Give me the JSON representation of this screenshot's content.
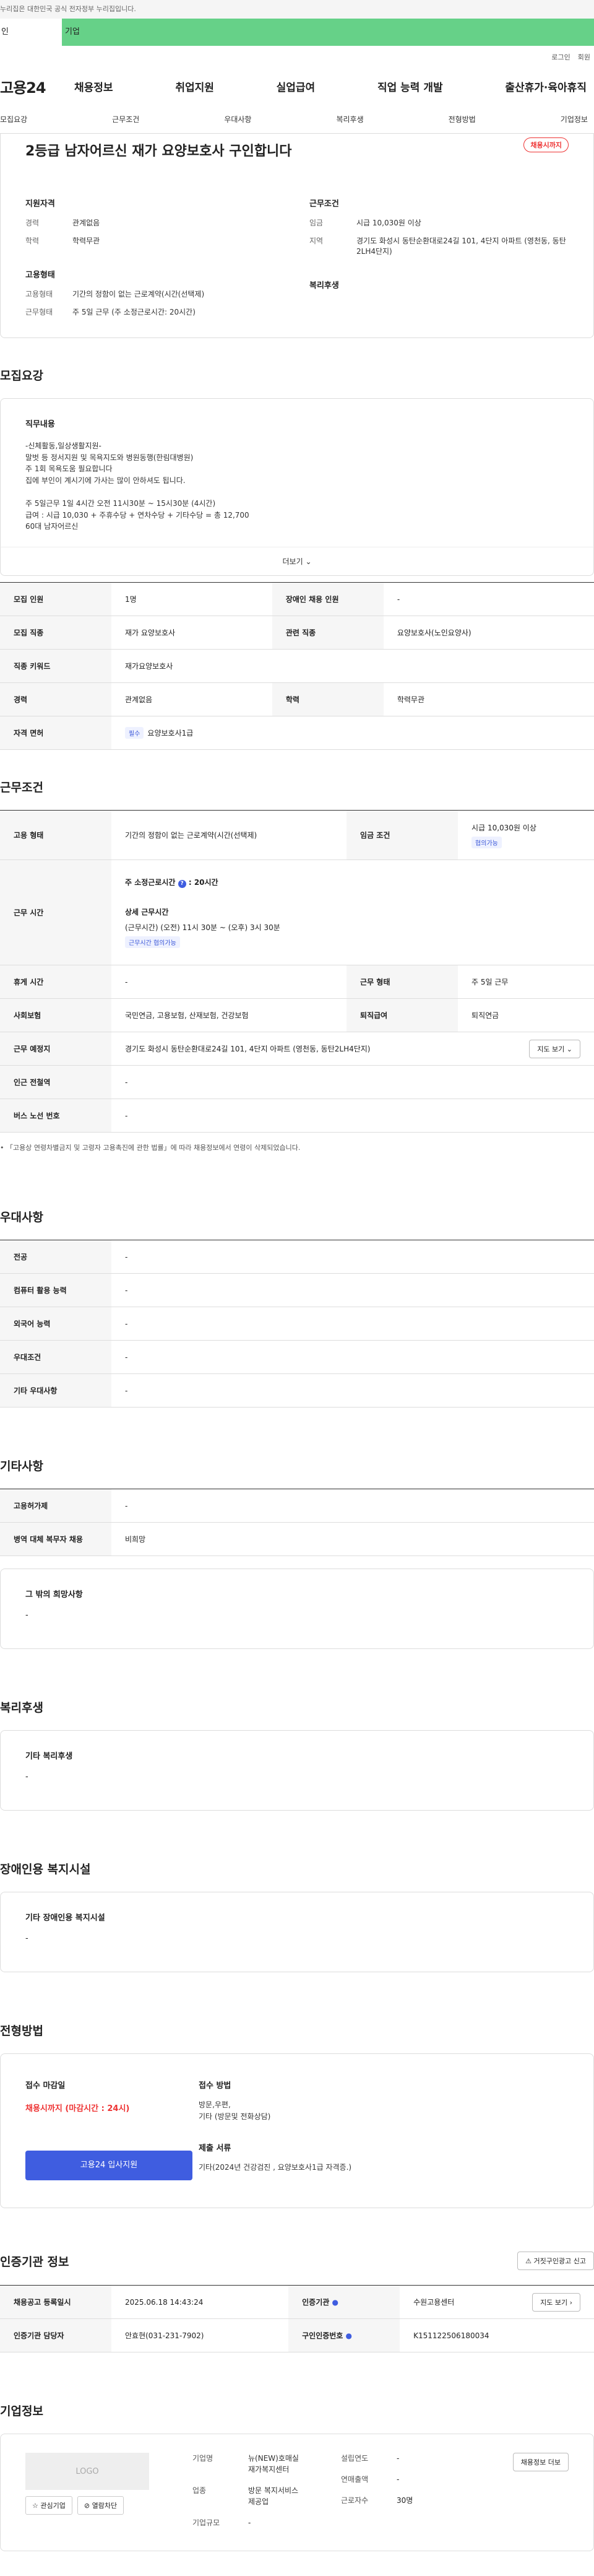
{
  "gov_notice": "누리집은 대한민국 공식 전자정부 누리집입니다.",
  "user_tabs": [
    "인",
    "기업"
  ],
  "top_links": [
    "로그인",
    "회원"
  ],
  "logo": "고용24",
  "gnb": [
    "채용정보",
    "취업지원",
    "실업급여",
    "직업 능력 개발",
    "출산휴가·육아휴직"
  ],
  "subnav": [
    "모집요강",
    "근무조건",
    "우대사항",
    "복리후생",
    "전형방법",
    "기업정보"
  ],
  "hero": {
    "title": "2등급 남자어르신 재가 요양보호사 구인합니다",
    "badge": "채용시까지",
    "qual_heading": "지원자격",
    "qual": [
      {
        "k": "경력",
        "v": "관계없음"
      },
      {
        "k": "학력",
        "v": "학력무관"
      }
    ],
    "cond_heading": "근무조건",
    "cond": [
      {
        "k": "임금",
        "v": "시급 10,030원 이상"
      },
      {
        "k": "지역",
        "v": "경기도 화성시 동탄순환대로24길 101, 4단지 아파트 (영천동, 동탄2LH4단지)"
      }
    ],
    "emp_heading": "고용형태",
    "emp": [
      {
        "k": "고용형태",
        "v": "기간의 정함이 없는 근로계약(시간(선택제)"
      },
      {
        "k": "근무형태",
        "v": "주 5일 근무 (주 소정근로시간: 20시간)"
      }
    ],
    "welfare_heading": "복리후생"
  },
  "recruit": {
    "title": "모집요강",
    "job_heading": "직무내용",
    "job_text": "-신체활동,일상생활지원-\n말벗 등 정서지원 및 목욕지도와 병원동행(한림대병원)\n주 1회 목욕도움 필요합니다\n집에 부인이 계시기에 가사는 많이 안하셔도 됩니다.\n\n주 5일근무 1일 4시간 오전 11시30분 ~ 15시30분 (4시간)\n급여 : 시급 10,030 + 주휴수당 + 연차수당 + 기타수당 = 총 12,700\n60대 남자어르신",
    "more": "더보기",
    "rows": [
      {
        "k1": "모집 인원",
        "v1": "1명",
        "k2": "장애인 채용 인원",
        "v2": "-"
      },
      {
        "k1": "모집 직종",
        "v1": "재가 요양보호사",
        "k2": "관련 직종",
        "v2": "요양보호사(노인요양사)"
      },
      {
        "k1": "직종 키워드",
        "v1": "재가요양보호사"
      },
      {
        "k1": "경력",
        "v1": "관계없음",
        "k2": "학력",
        "v2": "학력무관"
      },
      {
        "k1": "자격 면허",
        "v1": "요양보호사1급",
        "chip": "필수"
      }
    ]
  },
  "work": {
    "title": "근무조건",
    "type_k": "고용 형태",
    "type_v": "기간의 정함이 없는 근로계약(시간(선택제)",
    "wage_k": "임금 조건",
    "wage_v": "시급 10,030원 이상",
    "wage_chip": "협의가능",
    "hours_k": "근무 시간",
    "hours_weekly": "주 소정근로시간",
    "hours_weekly_v": "20시간",
    "hours_detail_h": "상세 근무시간",
    "hours_detail": "(근무시간) (오전) 11시 30분 ~ (오후) 3시 30분",
    "hours_chip": "근무시간 협의가능",
    "rest_k": "휴게 시간",
    "rest_v": "-",
    "form_k": "근무 형태",
    "form_v": "주 5일 근무",
    "ins_k": "사회보험",
    "ins_v": "국민연금, 고용보험, 산재보험, 건강보험",
    "ret_k": "퇴직급여",
    "ret_v": "퇴직연금",
    "place_k": "근무 예정지",
    "place_v": "경기도 화성시 동탄순환대로24길 101, 4단지 아파트 (영천동, 동탄2LH4단지)",
    "map_btn": "지도 보기",
    "subway_k": "인근 전철역",
    "subway_v": "-",
    "bus_k": "버스 노선 번호",
    "bus_v": "-",
    "note": "「고용상 연령차별금지 및 고령자 고용촉진에 관한 법률」에 따라 채용정보에서 연령이 삭제되었습니다."
  },
  "pref": {
    "title": "우대사항",
    "rows": [
      {
        "k": "전공",
        "v": "-"
      },
      {
        "k": "컴퓨터 활용 능력",
        "v": "-"
      },
      {
        "k": "외국어 능력",
        "v": "-"
      },
      {
        "k": "우대조건",
        "v": "-"
      },
      {
        "k": "기타 우대사항",
        "v": "-"
      }
    ]
  },
  "etc": {
    "title": "기타사항",
    "rows": [
      {
        "k": "고용허가제",
        "v": "-"
      },
      {
        "k": "병역 대체 복무자 채용",
        "v": "비희망"
      }
    ],
    "wish_h": "그 밖의 희망사항",
    "wish_v": "-"
  },
  "welfare": {
    "title": "복리후생",
    "h": "기타 복리후생",
    "v": "-"
  },
  "disabled": {
    "title": "장애인용 복지시설",
    "h": "기타 장애인용 복지시설",
    "v": "-"
  },
  "apply": {
    "title": "전형방법",
    "deadline_h": "접수 마감일",
    "deadline_v": "채용시까지 (마감시간 : 24시)",
    "btn": "고용24 입사지원",
    "method_h": "접수 방법",
    "method_v": "방문,우편,\n기타 (방문및 전화상담)",
    "docs_h": "제출 서류",
    "docs_v": "기타(2024년 건강검진 , 요양보호사1급 자격증.)"
  },
  "cert": {
    "title": "인증기관 정보",
    "report_btn": "거짓구인광고 신고",
    "rows": [
      {
        "k1": "채용공고 등록일시",
        "v1": "2025.06.18 14:43:24",
        "k2": "인증기관",
        "v2": "수원고용센터",
        "btn": "지도 보기"
      },
      {
        "k1": "인증기관 담당자",
        "v1": "안효현(031-231-7902)",
        "k2": "구인인증번호",
        "v2": "K151122506180034"
      }
    ]
  },
  "company": {
    "title": "기업정보",
    "logo": "LOGO",
    "btns": [
      "관심기업",
      "열람차단"
    ],
    "rows_left": [
      {
        "k": "기업명",
        "v": "뉴(NEW)호매실\n재가복지센터"
      },
      {
        "k": "업종",
        "v": "방문 복지서비스\n제공업"
      },
      {
        "k": "기업규모",
        "v": "-"
      }
    ],
    "rows_right": [
      {
        "k": "설립연도",
        "v": "-"
      },
      {
        "k": "연매출액",
        "v": "-"
      },
      {
        "k": "근로자수",
        "v": "30명"
      }
    ],
    "action": "채용정보 더보"
  }
}
